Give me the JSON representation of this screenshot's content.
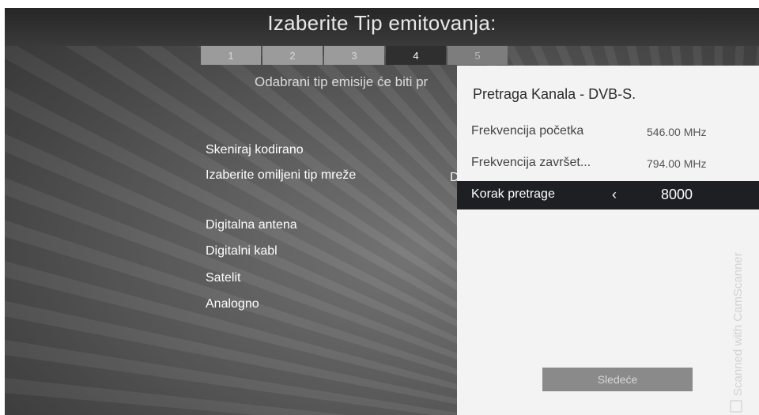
{
  "header": {
    "title": "Izaberite Tip emitovanja:"
  },
  "steps": [
    "1",
    "2",
    "3",
    "4",
    "5"
  ],
  "active_step": 4,
  "main": {
    "subtitle": "Odabrani tip emisije će biti pr",
    "options": {
      "scan_encrypted": "Skeniraj kodirano",
      "network_type": "Izaberite omiljeni tip mreže",
      "network_type_value": "D",
      "antenna": "Digitalna antena",
      "cable": "Digitalni kabl",
      "satellite": "Satelit",
      "analog": "Analogno"
    }
  },
  "panel": {
    "title": "Pretraga Kanala - DVB-S.",
    "rows": [
      {
        "label": "Frekvencija početka",
        "value": "546.00 MHz"
      },
      {
        "label": "Frekvencija završet...",
        "value": "794.00 MHz"
      },
      {
        "label": "Korak pretrage",
        "arrow": "‹",
        "value": "8000"
      }
    ],
    "next_label": "Sledeće"
  },
  "watermark": {
    "text": "Scanned with CamScanner"
  }
}
